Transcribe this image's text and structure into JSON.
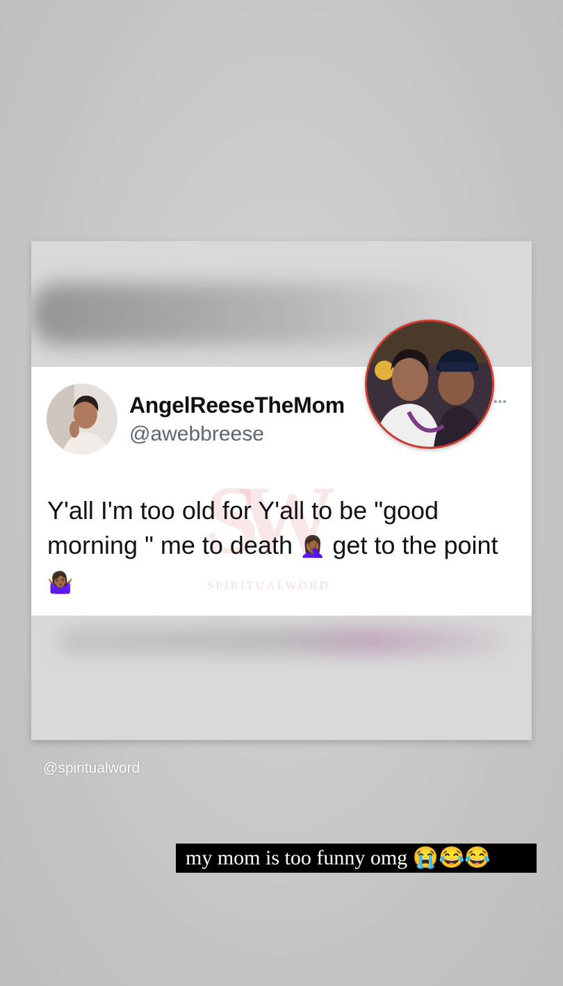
{
  "tweet": {
    "display_name": "AngelReeseTheMom",
    "handle": "@awebbreese",
    "more_label": "•••",
    "text_parts": [
      "Y'all I'm too old for Y'all to be \"good morning \" me to death ",
      "🤦🏾‍♀️",
      " get to the point ",
      "🤷🏾‍♀️"
    ]
  },
  "watermark": {
    "logo": "SW",
    "text": "SPIRITUALWORD"
  },
  "story": {
    "mention": "@spiritualword",
    "caption": "my mom is too funny omg 😭😂😂"
  },
  "colors": {
    "background": "#c9c9c9",
    "sticker_border": "#d33b2e",
    "caption_bg": "#000000",
    "handle": "#5b6770"
  },
  "icons": [
    "more-dots-icon",
    "facepalm-emoji",
    "shrug-emoji"
  ]
}
